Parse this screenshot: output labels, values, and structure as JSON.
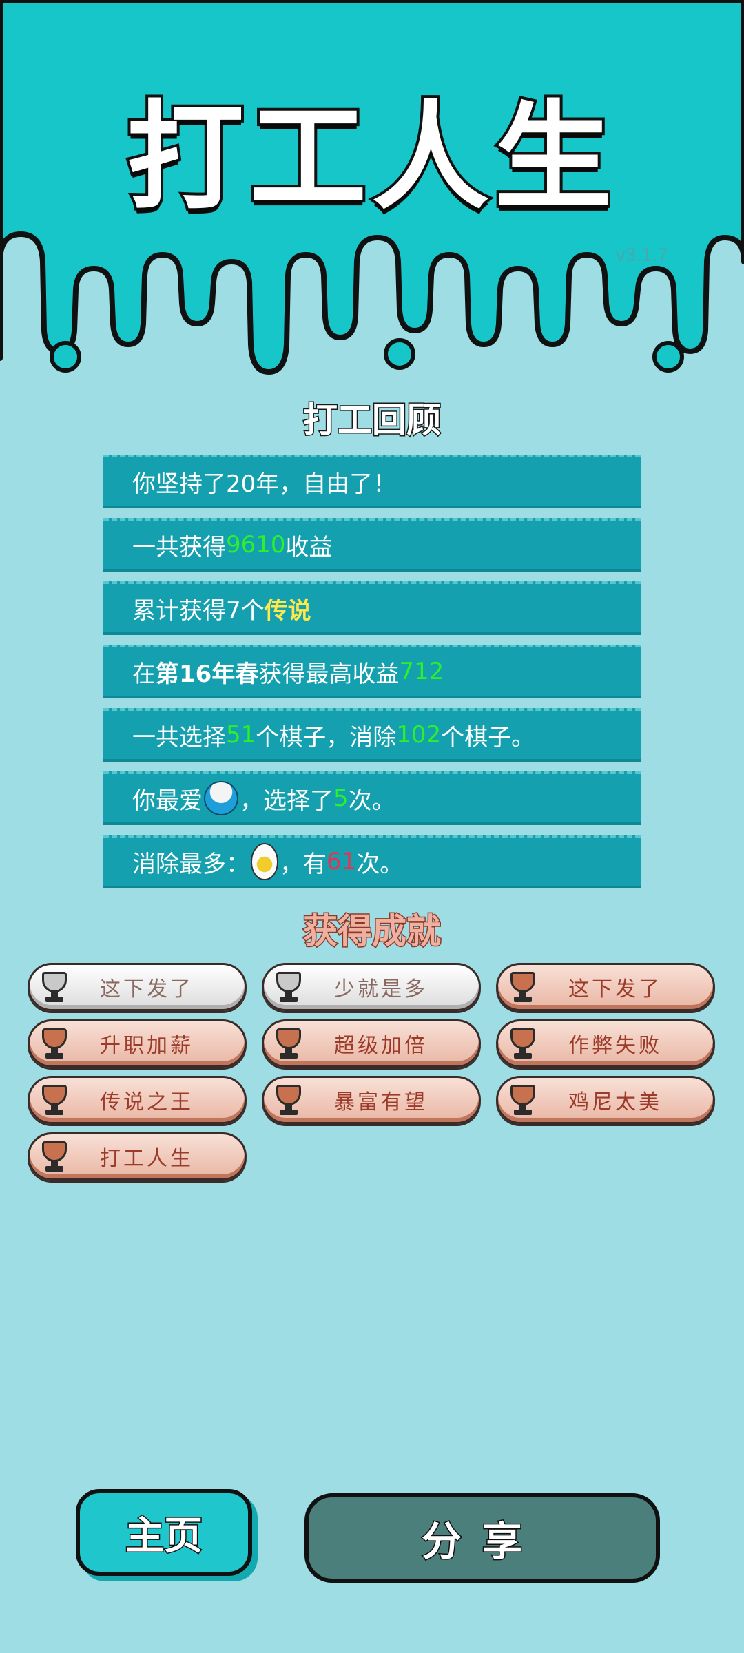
{
  "app": {
    "title": "打工人生",
    "version": "v3.1.7"
  },
  "review": {
    "heading": "打工回顾",
    "rows": [
      {
        "pre": "你坚持了20年，自由了！"
      },
      {
        "pre": "一共获得",
        "value": "9610",
        "post": "收益"
      },
      {
        "pre": "累计获得7个",
        "highlight": "传说"
      },
      {
        "pre": "在 ",
        "bold": "第16年春",
        "mid": " 获得最高收益",
        "value": "712"
      },
      {
        "pre": "一共选择",
        "v1": "51",
        "mid": "个棋子，消除",
        "v2": "102",
        "post": "个棋子。"
      },
      {
        "pre": "你最爱",
        "icon": "rice-bowl-icon",
        "mid": "，选择了",
        "value": "5",
        "post": "次。"
      },
      {
        "pre": "消除最多：",
        "icon": "egg-icon",
        "mid": "，有",
        "value": "61",
        "post": "次。"
      }
    ]
  },
  "achievements": {
    "heading": "获得成就",
    "items": [
      {
        "label": "这下发了",
        "tier": "silver"
      },
      {
        "label": "少就是多",
        "tier": "silver"
      },
      {
        "label": "这下发了",
        "tier": "bronze"
      },
      {
        "label": "升职加薪",
        "tier": "bronze"
      },
      {
        "label": "超级加倍",
        "tier": "bronze"
      },
      {
        "label": "作弊失败",
        "tier": "bronze"
      },
      {
        "label": "传说之王",
        "tier": "bronze"
      },
      {
        "label": "暴富有望",
        "tier": "bronze"
      },
      {
        "label": "鸡尼太美",
        "tier": "bronze"
      },
      {
        "label": "打工人生",
        "tier": "bronze"
      }
    ]
  },
  "buttons": {
    "home": "主页",
    "share": "分享"
  },
  "colors": {
    "header_bg": "#17c6c8",
    "page_bg": "#9edde4",
    "row_bg": "#14a0ae",
    "value_green": "#2cf02c",
    "legend_yellow": "#ffe94a",
    "value_red": "#e8334f"
  }
}
